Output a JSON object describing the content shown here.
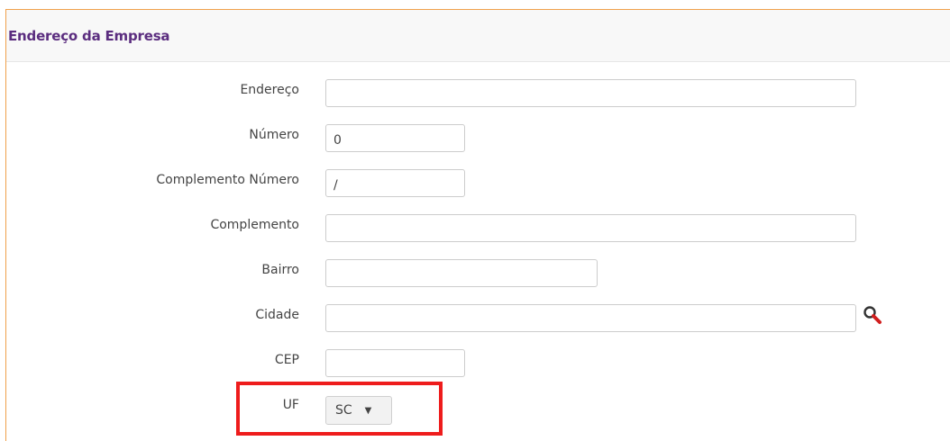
{
  "section": {
    "title": "Endereço da Empresa"
  },
  "fields": {
    "endereco": {
      "label": "Endereço",
      "value": ""
    },
    "numero": {
      "label": "Número",
      "value": "0"
    },
    "complemento_numero": {
      "label": "Complemento Número",
      "value": "/"
    },
    "complemento": {
      "label": "Complemento",
      "value": ""
    },
    "bairro": {
      "label": "Bairro",
      "value": ""
    },
    "cidade": {
      "label": "Cidade",
      "value": "",
      "icon": "search-icon"
    },
    "cep": {
      "label": "CEP",
      "value": ""
    },
    "uf": {
      "label": "UF",
      "selected": "SC"
    }
  },
  "colors": {
    "title": "#5b2d7f",
    "panel_border": "#f0a04b",
    "highlight": "#ee1c1c",
    "search_icon": "#d11f1f"
  }
}
